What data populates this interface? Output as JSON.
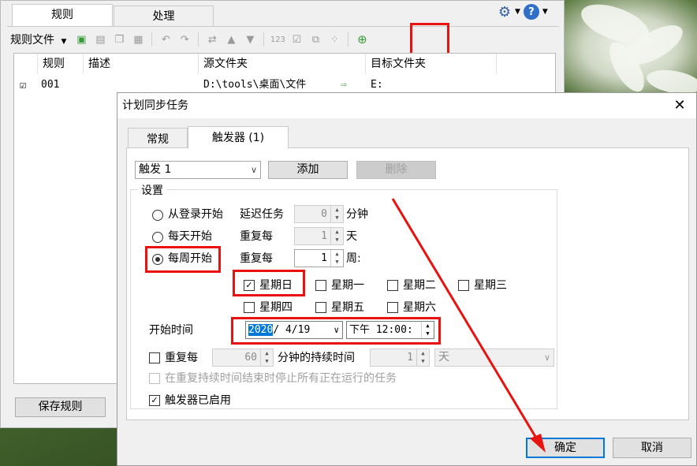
{
  "back_window": {
    "tabs": [
      "规则",
      "处理"
    ],
    "toolbar_label": "规则文件",
    "table": {
      "headers": [
        "规则",
        "描述",
        "源文件夹",
        "目标文件夹"
      ],
      "row": {
        "checked": "☑",
        "rule": "001",
        "description": "",
        "source": "D:\\tools\\桌面\\文件",
        "target": "E:"
      }
    },
    "save_button": "保存规则"
  },
  "dialog": {
    "title": "计划同步任务",
    "close": "✕",
    "tabs": [
      "常规",
      "触发器 (1)"
    ],
    "trigger_select": "触发 1",
    "add_button": "添加",
    "delete_button": "删除",
    "group_title": "设置",
    "options": [
      {
        "label": "从登录开始",
        "sub": "延迟任务",
        "value": "0",
        "unit": "分钟",
        "selected": false
      },
      {
        "label": "每天开始",
        "sub": "重复每",
        "value": "1",
        "unit": "天",
        "selected": false
      },
      {
        "label": "每周开始",
        "sub": "重复每",
        "value": "1",
        "unit": "周:",
        "selected": true
      }
    ],
    "weekdays": [
      {
        "label": "星期日",
        "checked": true
      },
      {
        "label": "星期一",
        "checked": false
      },
      {
        "label": "星期二",
        "checked": false
      },
      {
        "label": "星期三",
        "checked": false
      },
      {
        "label": "星期四",
        "checked": false
      },
      {
        "label": "星期五",
        "checked": false
      },
      {
        "label": "星期六",
        "checked": false
      }
    ],
    "start_time_label": "开始时间",
    "date_year": "2020",
    "date_rest": "/ 4/19",
    "time_value": "下午 12:00:",
    "repeat_label": "重复每",
    "repeat_value": "60",
    "repeat_unit": "分钟的持续时间",
    "duration_value": "1",
    "duration_unit": "天",
    "stop_label": "在重复持续时间结束时停止所有正在运行的任务",
    "enabled_label": "触发器已启用",
    "ok_button": "确定",
    "cancel_button": "取消"
  },
  "colors": {
    "highlight": "#e8120f",
    "accent": "#0078d7"
  }
}
